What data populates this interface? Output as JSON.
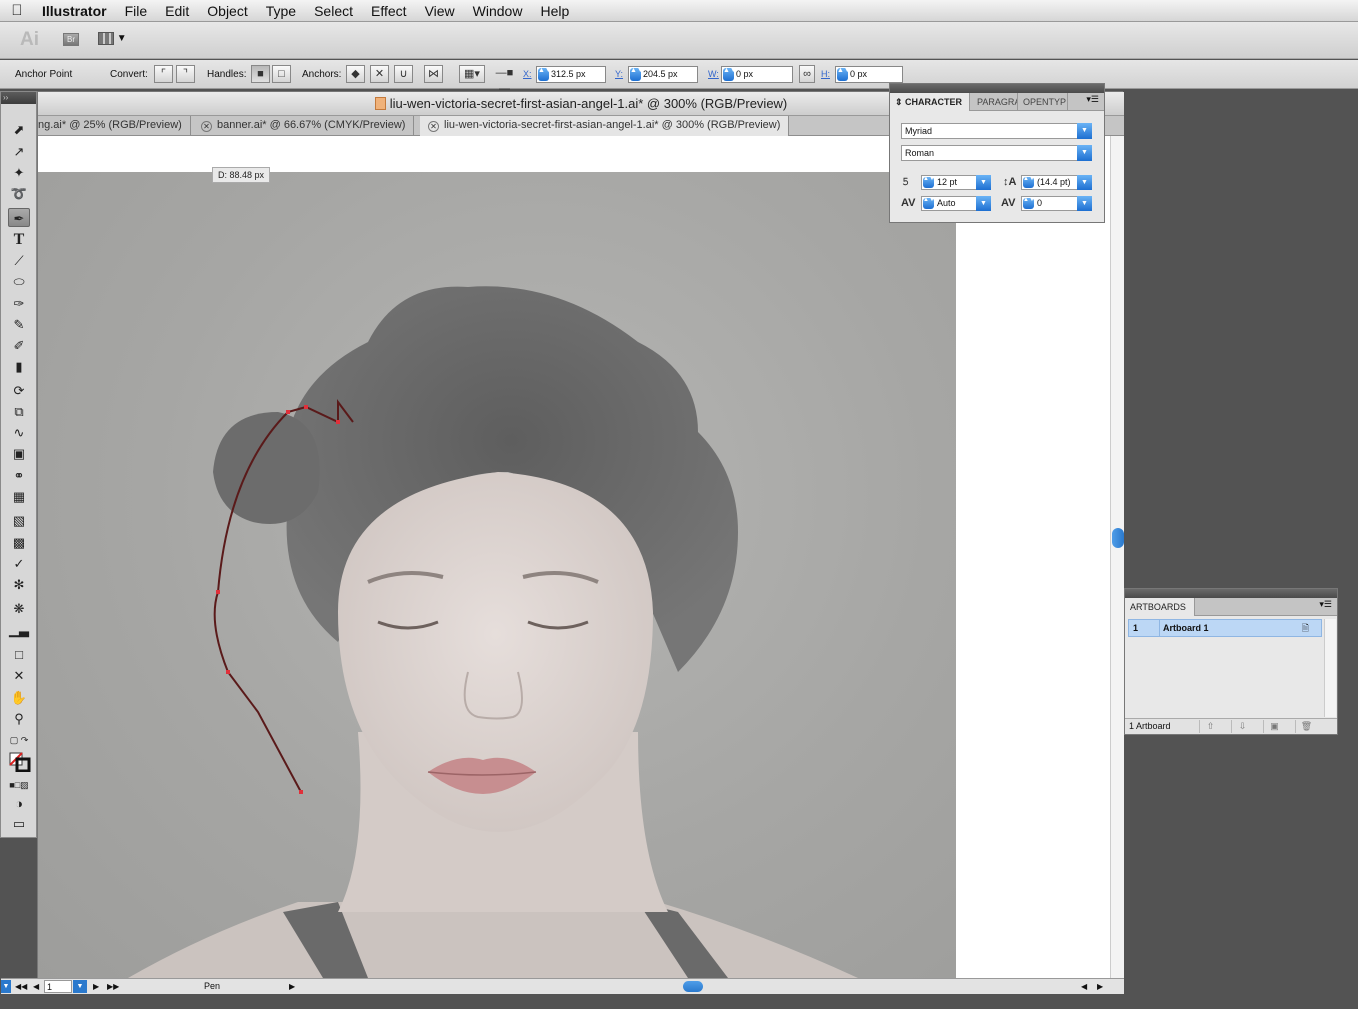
{
  "menubar": {
    "app_name": "Illustrator",
    "items": [
      "File",
      "Edit",
      "Object",
      "Type",
      "Select",
      "Effect",
      "View",
      "Window",
      "Help"
    ]
  },
  "appbar": {
    "logo": "Ai",
    "bridge": "Br"
  },
  "controlbar": {
    "context": "Anchor Point",
    "convert_label": "Convert:",
    "handles_label": "Handles:",
    "anchors_label": "Anchors:",
    "x_label": "X:",
    "x_value": "312.5 px",
    "y_label": "Y:",
    "y_value": "204.5 px",
    "w_label": "W:",
    "w_value": "0 px",
    "h_label": "H:",
    "h_value": "0 px"
  },
  "document": {
    "title": "liu-wen-victoria-secret-first-asian-angel-1.ai* @ 300% (RGB/Preview)",
    "tabs": [
      {
        "label": "ng.ai* @ 25% (RGB/Preview)"
      },
      {
        "label": "banner.ai* @ 66.67% (CMYK/Preview)"
      },
      {
        "label": "liu-wen-victoria-secret-first-asian-angel-1.ai* @ 300% (RGB/Preview)"
      }
    ],
    "distance_tip": "D: 88.48 px"
  },
  "statusbar": {
    "artboard_number": "1",
    "tool_name": "Pen"
  },
  "character_panel": {
    "tabs": [
      "CHARACTER",
      "PARAGRA",
      "OPENTYP"
    ],
    "font_family": "Myriad",
    "font_style": "Roman",
    "font_size": "12 pt",
    "leading": "(14.4 pt)",
    "kerning": "Auto",
    "tracking": "0"
  },
  "artboards_panel": {
    "title": "ARTBOARDS",
    "rows": [
      {
        "number": "1",
        "name": "Artboard 1"
      }
    ],
    "count": "1 Artboard"
  },
  "colors": {
    "accent": "#2a79cd",
    "path_stroke": "#5a1a1a",
    "anchor": "#e0303a"
  }
}
